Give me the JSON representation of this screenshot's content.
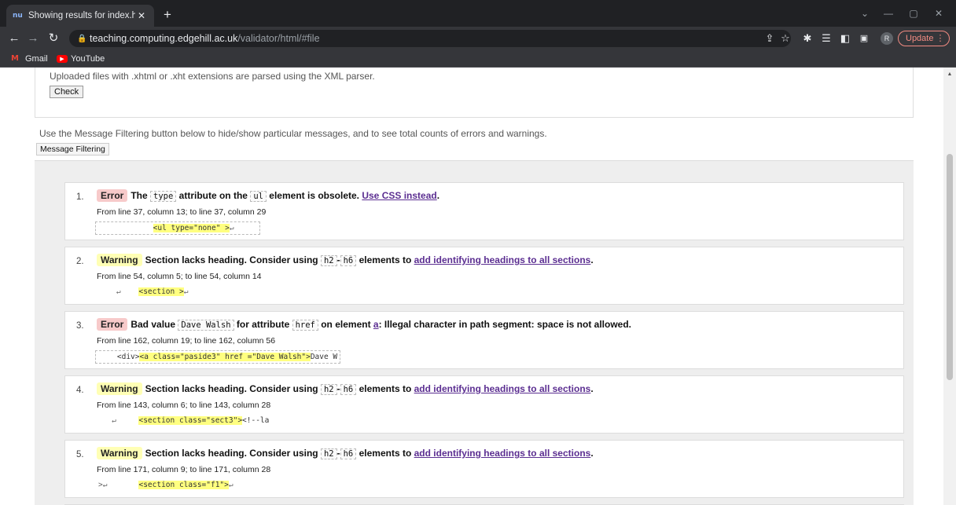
{
  "browser": {
    "tab_title": "Showing results for index.html - N",
    "tab_favicon": "nu",
    "url_host": "teaching.computing.edgehill.ac.uk",
    "url_path": "/validator/html/#file",
    "avatar_letter": "R",
    "update_label": "Update",
    "bookmarks": [
      {
        "label": "Gmail",
        "icon": "gmail-icon",
        "color": "#ea4335"
      },
      {
        "label": "YouTube",
        "icon": "youtube-icon",
        "color": "#ff0000"
      }
    ]
  },
  "form": {
    "upload_note": "Uploaded files with .xhtml or .xht extensions are parsed using the XML parser.",
    "check_label": "Check",
    "filter_note": "Use the Message Filtering button below to hide/show particular messages, and to see total counts of errors and warnings.",
    "filter_label": "Message Filtering"
  },
  "messages": [
    {
      "num": "1.",
      "type": "Error",
      "t1": "The ",
      "c1": "type",
      "t2": " attribute on the ",
      "c2": "ul",
      "t3": " element is obsolete. ",
      "link": "Use CSS instead",
      "t4": ".",
      "location": "From line 37, column 13; to line 37, column 29",
      "pre": "            ",
      "hl": "<ul type=\"none\" >",
      "post": "↵"
    },
    {
      "num": "2.",
      "type": "Warning",
      "t1": "Section lacks heading. Consider using ",
      "c1": "h2",
      "t2": "-",
      "c2": "h6",
      "t3": " elements to ",
      "link": "add identifying headings to all sections",
      "t4": ".",
      "location": "From line 54, column 5; to line 54, column 14",
      "pre": "    ↵    ",
      "hl": "<section >",
      "post": "↵"
    },
    {
      "num": "3.",
      "type": "Error",
      "t1": "Bad value ",
      "c1": "Dave Walsh",
      "t2": " for attribute ",
      "c2": "href",
      "t3": " on element ",
      "c3": "a",
      "t4": ": Illegal character in path segment: space is not allowed.",
      "location": "From line 162, column 19; to line 162, column 56",
      "pre": "    <div>",
      "hl": "<a class=\"paside3\" href =\"Dave Walsh\">",
      "post": "Dave W"
    },
    {
      "num": "4.",
      "type": "Warning",
      "t1": "Section lacks heading. Consider using ",
      "c1": "h2",
      "t2": "-",
      "c2": "h6",
      "t3": " elements to ",
      "link": "add identifying headings to all sections",
      "t4": ".",
      "location": "From line 143, column 6; to line 143, column 28",
      "pre": "   ↵     ",
      "hl": "<section class=\"sect3\">",
      "post": "<!--la"
    },
    {
      "num": "5.",
      "type": "Warning",
      "t1": "Section lacks heading. Consider using ",
      "c1": "h2",
      "t2": "-",
      "c2": "h6",
      "t3": " elements to ",
      "link": "add identifying headings to all sections",
      "t4": ".",
      "location": "From line 171, column 9; to line 171, column 28",
      "pre": ">↵       ",
      "hl": "<section class=\"f1\">",
      "post": "↵"
    }
  ]
}
